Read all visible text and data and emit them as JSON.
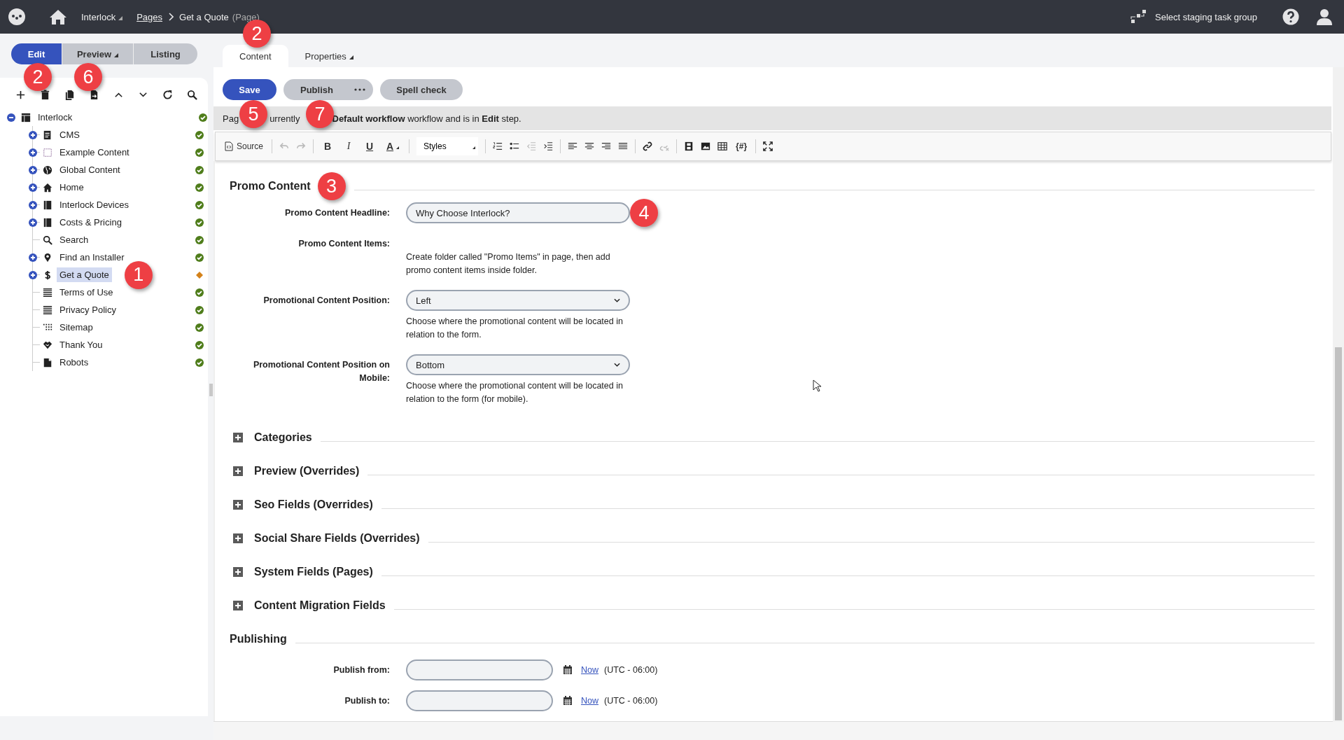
{
  "topbar": {
    "site": "Interlock",
    "breadcrumb": [
      {
        "label": "Pages",
        "link": true
      },
      {
        "label": "Get a Quote",
        "link": false
      }
    ],
    "page_type": "(Page)",
    "staging": "Select staging task group"
  },
  "modes": [
    {
      "label": "Edit",
      "selected": true,
      "dropdown": false,
      "callout": "2"
    },
    {
      "label": "Preview",
      "selected": false,
      "dropdown": true,
      "callout": "6"
    },
    {
      "label": "Listing",
      "selected": false,
      "dropdown": false
    }
  ],
  "tree": {
    "label": "Interlock",
    "expanded": true,
    "published": true,
    "children": [
      {
        "label": "CMS",
        "expandable": true,
        "selected": false,
        "published": true
      },
      {
        "label": "Example Content",
        "expandable": true,
        "selected": false,
        "published": true
      },
      {
        "label": "Global Content",
        "expandable": true,
        "selected": false,
        "published": true
      },
      {
        "label": "Home",
        "expandable": true,
        "selected": false,
        "published": true
      },
      {
        "label": "Interlock Devices",
        "expandable": true,
        "selected": false,
        "published": true
      },
      {
        "label": "Costs & Pricing",
        "expandable": true,
        "selected": false,
        "published": true
      },
      {
        "label": "Search",
        "expandable": false,
        "selected": false,
        "published": true
      },
      {
        "label": "Find an Installer",
        "expandable": true,
        "selected": false,
        "published": true
      },
      {
        "label": "Get a Quote",
        "expandable": true,
        "selected": true,
        "published": false,
        "callout": "1"
      },
      {
        "label": "Terms of Use",
        "expandable": false,
        "selected": false,
        "published": true
      },
      {
        "label": "Privacy Policy",
        "expandable": false,
        "selected": false,
        "published": true
      },
      {
        "label": "Sitemap",
        "expandable": false,
        "selected": false,
        "published": true
      },
      {
        "label": "Thank You",
        "expandable": false,
        "selected": false,
        "published": true
      },
      {
        "label": "Robots",
        "expandable": false,
        "selected": false,
        "published": true
      }
    ]
  },
  "tabs": [
    {
      "label": "Content",
      "selected": true,
      "dropdown": false,
      "callout": "2"
    },
    {
      "label": "Properties",
      "selected": false,
      "dropdown": true
    }
  ],
  "actions": [
    {
      "label": "Save",
      "kind": "primary",
      "callout": "5"
    },
    {
      "label": "Publish",
      "kind": "split",
      "callout": "7"
    },
    {
      "label": "Spell check",
      "kind": "secondary"
    }
  ],
  "workflow_message": [
    "Pag",
    "urrently",
    "**Default workflow** workflow and is in **Edit** step."
  ],
  "editor_toolbar": {
    "source": "Source",
    "format": [
      "B",
      "I",
      "U",
      "A"
    ],
    "styles": "Styles",
    "variable": "{#}"
  },
  "section": {
    "title": "Promo Content",
    "callout": "3",
    "fields": [
      {
        "label": "Promo Content Headline:",
        "kind": "text",
        "value": "Why Choose Interlock?",
        "callout": "4"
      },
      {
        "label": "Promo Content Items:",
        "kind": "note",
        "help": "Create folder called \"Promo Items\" in page, then add promo content items inside folder."
      },
      {
        "label": "Promotional Content Position:",
        "kind": "select",
        "value": "Left",
        "help": "Choose where the promotional content will be located in relation to the form."
      },
      {
        "label": "Promotional Content Position on Mobile:",
        "kind": "select",
        "value": "Bottom",
        "help": "Choose where the promotional content will be located in relation to the form (for mobile)."
      }
    ]
  },
  "collapsed_sections": [
    "Categories",
    "Preview (Overrides)",
    "Seo Fields (Overrides)",
    "Social Share Fields (Overrides)",
    "System Fields (Pages)",
    "Content Migration Fields"
  ],
  "publishing": {
    "title": "Publishing",
    "fields": [
      {
        "label": "Publish from:",
        "link": "Now",
        "timezone": "(UTC - 06:00)"
      },
      {
        "label": "Publish to:",
        "link": "Now",
        "timezone": "(UTC - 06:00)"
      }
    ]
  }
}
